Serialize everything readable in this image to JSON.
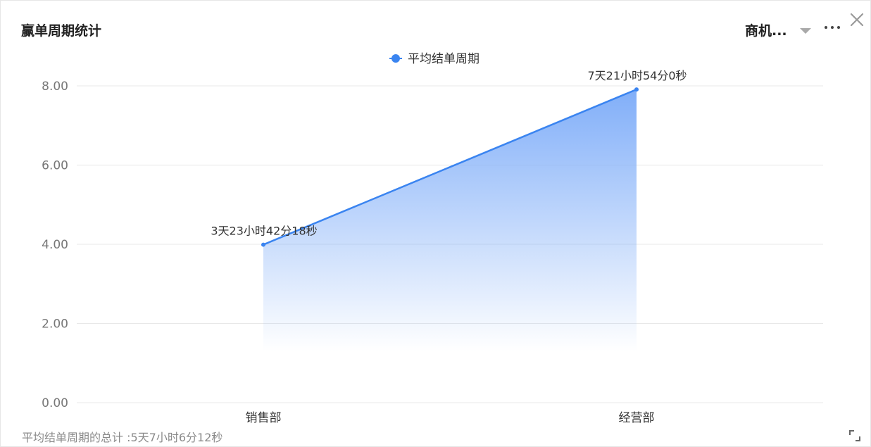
{
  "header": {
    "title": "赢单周期统计",
    "selector_label": "商机...",
    "more_icon": "more-horizontal-icon",
    "close_icon": "close-icon"
  },
  "footer": {
    "total_text": "平均结单周期的总计 :5天7小时6分12秒",
    "resize_icon": "expand-corner-icon"
  },
  "chart_data": {
    "type": "area",
    "categories": [
      "销售部",
      "经营部"
    ],
    "series": [
      {
        "name": "平均结单周期",
        "values": [
          3.99,
          7.91
        ],
        "labels": [
          "3天23小时42分18秒",
          "7天21小时54分0秒"
        ]
      }
    ],
    "yticks": [
      "0.00",
      "2.00",
      "4.00",
      "6.00",
      "8.00"
    ],
    "ylim": [
      0,
      8
    ],
    "grid": true,
    "legend": "top-center",
    "colors": {
      "line": "#3a84f0",
      "fill_top": "#7aaaf8",
      "grid": "#e8e8e8",
      "axis_text": "#777777",
      "label_text": "#333333"
    }
  }
}
